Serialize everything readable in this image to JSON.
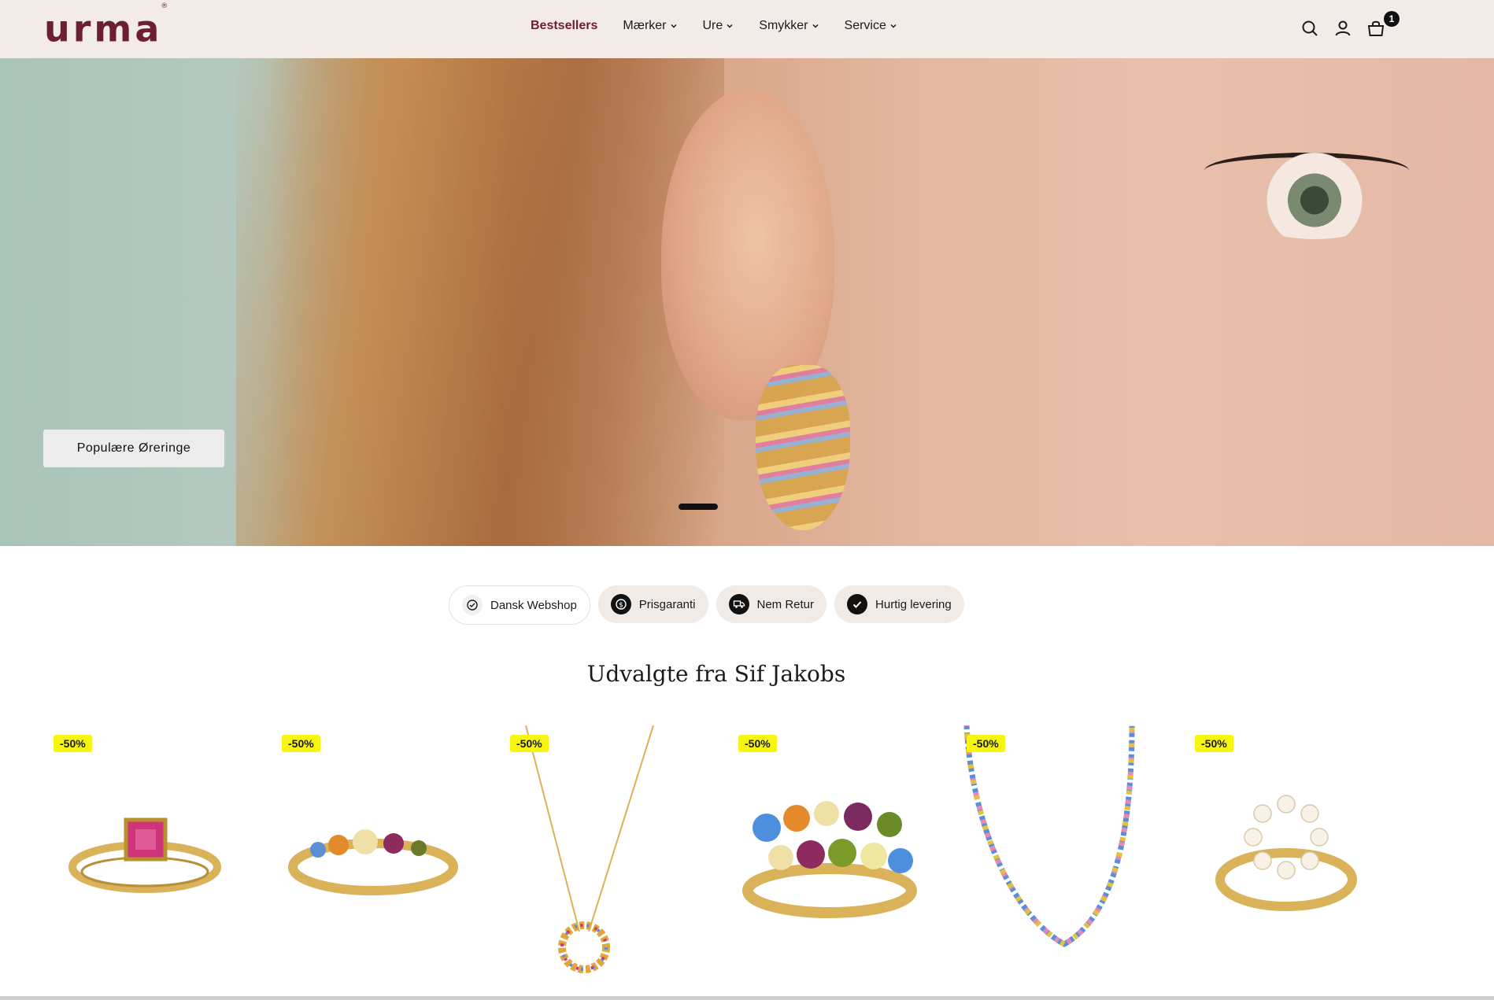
{
  "header": {
    "logo": "urma",
    "logo_mark": "®",
    "nav": [
      {
        "label": "Bestsellers",
        "active": true,
        "dropdown": false
      },
      {
        "label": "Mærker",
        "active": false,
        "dropdown": true
      },
      {
        "label": "Ure",
        "active": false,
        "dropdown": true
      },
      {
        "label": "Smykker",
        "active": false,
        "dropdown": true
      },
      {
        "label": "Service",
        "active": false,
        "dropdown": true
      }
    ],
    "icons": [
      "search-icon",
      "user-icon",
      "cart-icon"
    ],
    "cart_count": "1"
  },
  "hero": {
    "cta_label": "Populære Øreringe",
    "slide_indicator": "active"
  },
  "trust_badges": [
    {
      "label": "Dansk Webshop",
      "icon": "verified-icon"
    },
    {
      "label": "Prisgaranti",
      "icon": "dollar-icon"
    },
    {
      "label": "Nem Retur",
      "icon": "truck-icon"
    },
    {
      "label": "Hurtig levering",
      "icon": "check-icon"
    }
  ],
  "section": {
    "title": "Udvalgte fra Sif Jakobs"
  },
  "products": [
    {
      "badge": "-50%",
      "kind": "ring-pink-stone"
    },
    {
      "badge": "-50%",
      "kind": "ring-multicolor-band"
    },
    {
      "badge": "-50%",
      "kind": "necklace-circle-pendant"
    },
    {
      "badge": "-50%",
      "kind": "ring-multicolor-cluster"
    },
    {
      "badge": "-50%",
      "kind": "necklace-tennis"
    },
    {
      "badge": "-50%",
      "kind": "ring-pearl-circle"
    }
  ],
  "colors": {
    "brand": "#6b1f33",
    "header_bg": "#f2ebe8",
    "sale_badge": "#f5f50f"
  }
}
